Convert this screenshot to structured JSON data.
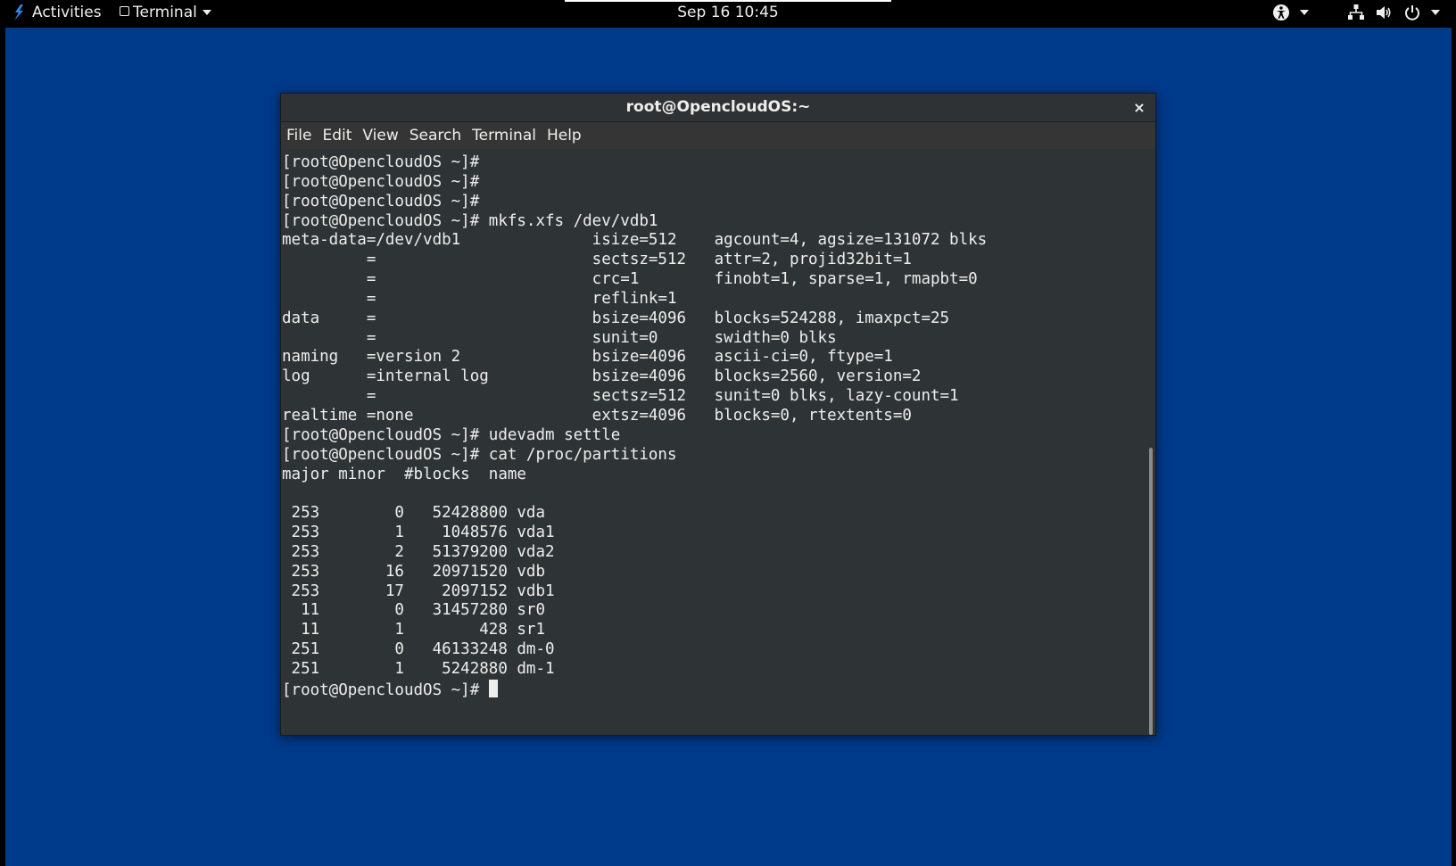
{
  "topbar": {
    "activities_label": "Activities",
    "app_menu_label": "Terminal",
    "clock": "Sep 16  10:45",
    "icons": [
      "accessibility-icon",
      "network-icon",
      "volume-icon",
      "power-icon"
    ]
  },
  "window": {
    "title": "root@OpencloudOS:~",
    "close_glyph": "×"
  },
  "menubar": {
    "items": [
      "File",
      "Edit",
      "View",
      "Search",
      "Terminal",
      "Help"
    ]
  },
  "terminal": {
    "lines": [
      "[root@OpencloudOS ~]#",
      "[root@OpencloudOS ~]#",
      "[root@OpencloudOS ~]#",
      "[root@OpencloudOS ~]# mkfs.xfs /dev/vdb1",
      "meta-data=/dev/vdb1              isize=512    agcount=4, agsize=131072 blks",
      "         =                       sectsz=512   attr=2, projid32bit=1",
      "         =                       crc=1        finobt=1, sparse=1, rmapbt=0",
      "         =                       reflink=1",
      "data     =                       bsize=4096   blocks=524288, imaxpct=25",
      "         =                       sunit=0      swidth=0 blks",
      "naming   =version 2              bsize=4096   ascii-ci=0, ftype=1",
      "log      =internal log           bsize=4096   blocks=2560, version=2",
      "         =                       sectsz=512   sunit=0 blks, lazy-count=1",
      "realtime =none                   extsz=4096   blocks=0, rtextents=0",
      "[root@OpencloudOS ~]# udevadm settle",
      "[root@OpencloudOS ~]# cat /proc/partitions",
      "major minor  #blocks  name",
      "",
      " 253        0   52428800 vda",
      " 253        1    1048576 vda1",
      " 253        2   51379200 vda2",
      " 253       16   20971520 vdb",
      " 253       17    2097152 vdb1",
      "  11        0   31457280 sr0",
      "  11        1        428 sr1",
      " 251        0   46133248 dm-0",
      " 251        1    5242880 dm-1"
    ],
    "prompt": "[root@OpencloudOS ~]# "
  },
  "colors": {
    "desktop_bg": "#003a8b",
    "topbar_bg": "#000000",
    "terminal_bg": "#2e3436",
    "terminal_fg": "#eeeeec"
  }
}
